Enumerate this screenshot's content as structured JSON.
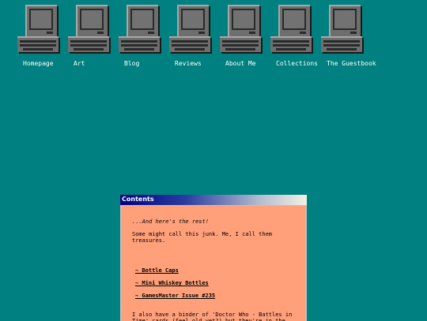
{
  "nav": {
    "items": [
      {
        "label": "Homepage"
      },
      {
        "label": "Art"
      },
      {
        "label": "Blog"
      },
      {
        "label": "Reviews"
      },
      {
        "label": "About Me"
      },
      {
        "label": "Collections"
      },
      {
        "label": "The Guestbook"
      }
    ],
    "icon": "retro-computer-icon"
  },
  "window": {
    "title": "Contents",
    "intro": "...And here's the rest!",
    "paragraph1": "Some might call this junk. Me, I call them treasures.",
    "links": [
      {
        "label": "~ Bottle Caps"
      },
      {
        "label": "~ Mini Whiskey Bottles"
      },
      {
        "label": "~ GamesMaster Issue #235"
      }
    ],
    "paragraph2": "I also have a binder of 'Doctor Who - Battles in Time' cards (feel old yet?) but they're in the loft and I can't be bothered to get them down to"
  },
  "colors": {
    "background": "#008080",
    "content": "#ffa07a",
    "titlebar_start": "#000080",
    "titlebar_end": "#f2f0e6"
  }
}
